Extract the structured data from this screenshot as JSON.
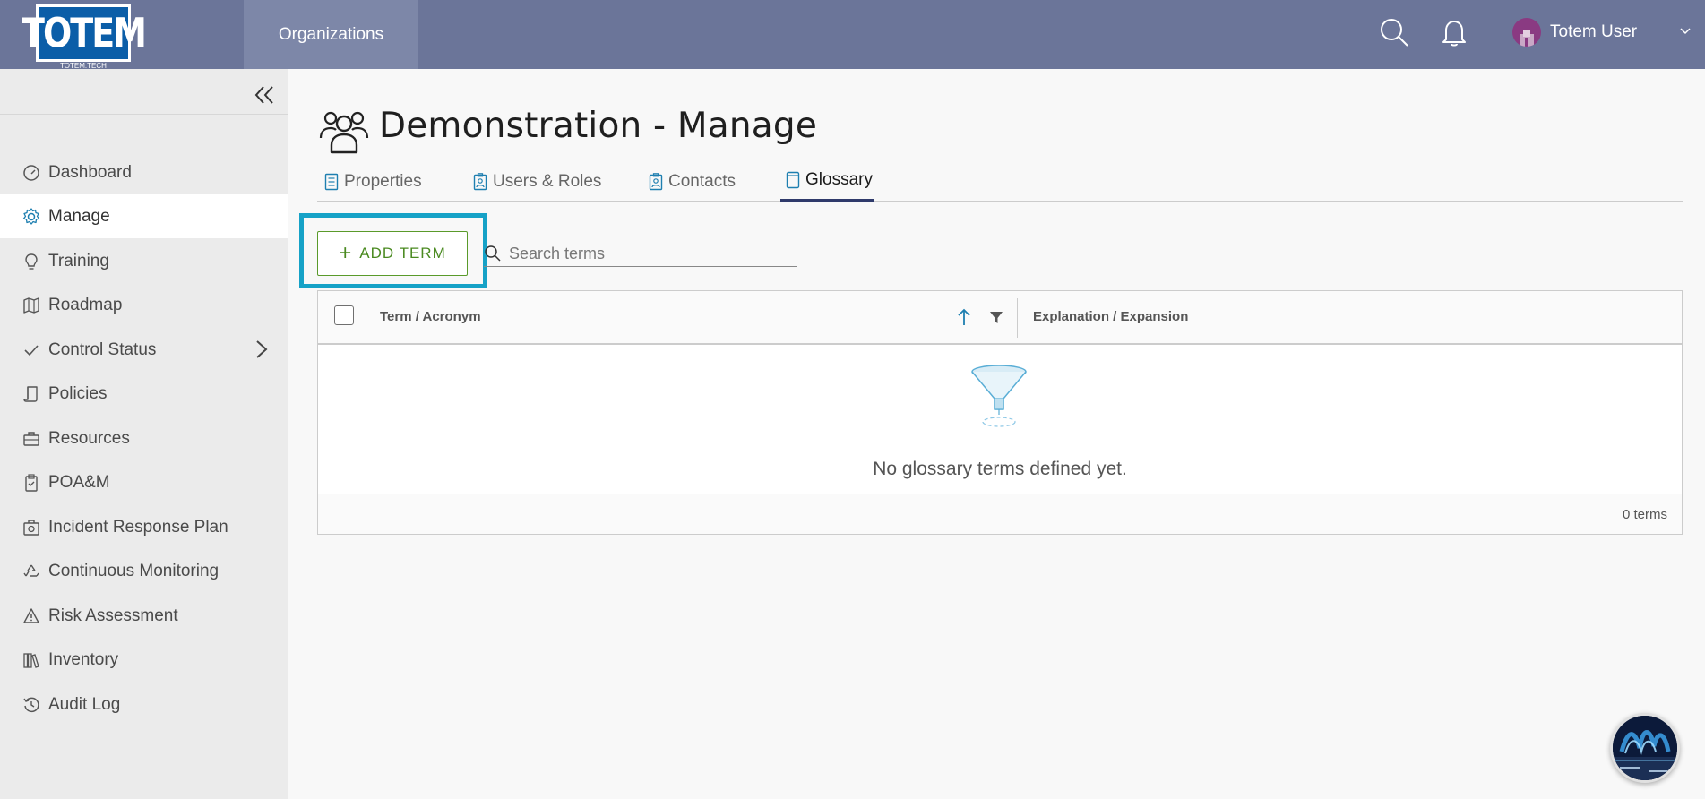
{
  "header": {
    "logo_text": "TOTEM",
    "logo_sub": "TOTEM.TECH",
    "nav_organizations": "Organizations",
    "user_name": "Totem User",
    "colors": {
      "bar": "#6b7599",
      "active_nav": "#7d87a8"
    }
  },
  "sidebar": {
    "items": [
      {
        "label": "Dashboard",
        "icon": "gauge-icon"
      },
      {
        "label": "Manage",
        "icon": "gear-icon",
        "active": true
      },
      {
        "label": "Training",
        "icon": "lightbulb-icon"
      },
      {
        "label": "Roadmap",
        "icon": "map-icon"
      },
      {
        "label": "Control Status",
        "icon": "check-icon",
        "has_submenu": true
      },
      {
        "label": "Policies",
        "icon": "scroll-icon"
      },
      {
        "label": "Resources",
        "icon": "briefcase-icon"
      },
      {
        "label": "POA&M",
        "icon": "clipboard-check-icon"
      },
      {
        "label": "Incident Response Plan",
        "icon": "first-aid-kit-icon"
      },
      {
        "label": "Continuous Monitoring",
        "icon": "recycle-icon"
      },
      {
        "label": "Risk Assessment",
        "icon": "warning-icon"
      },
      {
        "label": "Inventory",
        "icon": "books-icon"
      },
      {
        "label": "Audit Log",
        "icon": "history-icon"
      }
    ]
  },
  "page": {
    "title": "Demonstration - Manage",
    "tabs": [
      {
        "label": "Properties",
        "icon": "document-icon"
      },
      {
        "label": "Users & Roles",
        "icon": "badge-icon"
      },
      {
        "label": "Contacts",
        "icon": "contact-badge-icon"
      },
      {
        "label": "Glossary",
        "icon": "book-icon",
        "active": true
      }
    ]
  },
  "toolbar": {
    "add_label": "ADD TERM",
    "search_placeholder": "Search terms"
  },
  "grid": {
    "columns": [
      "Term / Acronym",
      "Explanation / Expansion"
    ],
    "empty_message": "No glossary terms defined yet.",
    "footer_count": "0 terms"
  },
  "colors": {
    "accent_green": "#4a8a20",
    "focus_ring": "#16a2c7",
    "tab_active": "#2f3a6b",
    "icon_blue": "#1e7fb0"
  }
}
